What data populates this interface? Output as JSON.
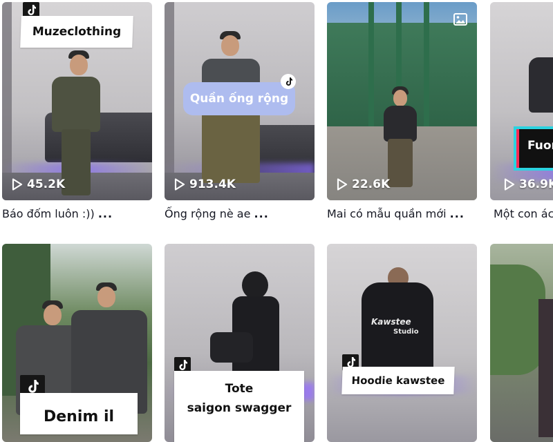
{
  "videos": [
    {
      "overlay_title": "Muzeclothing",
      "views": "45.2K",
      "caption": "Báo đốm luôn :))",
      "ellipsis": "..."
    },
    {
      "overlay_title": "Quần ống rộng",
      "views": "913.4K",
      "caption": "Ống rộng nè ae",
      "ellipsis": "..."
    },
    {
      "overlay_title": "",
      "views": "22.6K",
      "caption": "Mai có mẫu quần mới",
      "ellipsis": "..."
    },
    {
      "overlay_title": "Fuon",
      "views": "36.9K",
      "caption": "Một con ác",
      "ellipsis": ""
    },
    {
      "overlay_title": "Denim il"
    },
    {
      "overlay_title_line1": "Tote",
      "overlay_title_line2": "saigon swagger"
    },
    {
      "overlay_title": "Hoodie kawstee",
      "hoodie_print_1": "Kawstee",
      "hoodie_print_2": "Studio"
    },
    {
      "overlay_title": ""
    }
  ],
  "icons": {
    "play": "play-icon",
    "tiktok": "tiktok-icon",
    "photo": "image-icon"
  },
  "colors": {
    "accent_pill": "#aebcef",
    "text": "#161823",
    "neon_cyan": "#2bd3e0",
    "neon_red": "#ff2b55"
  }
}
